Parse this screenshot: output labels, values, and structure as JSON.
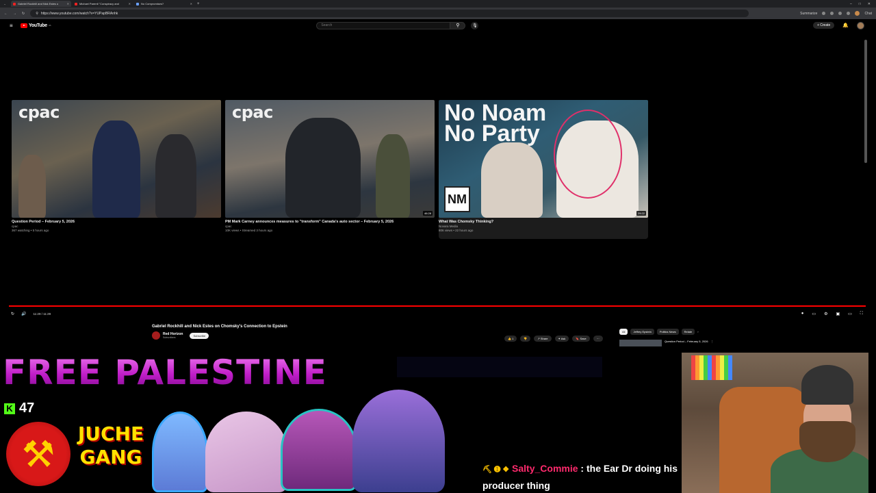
{
  "browser": {
    "tabs": [
      {
        "title": "Gabriel Rockhill and Nick Estes o",
        "active": true
      },
      {
        "title": "Michael Parenti \"Conspiracy and",
        "active": false
      },
      {
        "title": "No Compromises?",
        "active": false
      }
    ],
    "url": "https://www.youtube.com/watch?v=YUPapBRAnhk",
    "summarize_label": "Summarize",
    "chat_label": "Chat"
  },
  "youtube": {
    "logo_text": "YouTube",
    "logo_region": "CA",
    "search_placeholder": "Search",
    "create_label": "Create"
  },
  "end_screen": {
    "videos": [
      {
        "title": "Question Period – February 5, 2026",
        "channel": "cpac",
        "meta": "367 watching • 5 hours ago",
        "brand": "cpac",
        "duration": ""
      },
      {
        "title": "PM Mark Carney announces measures to \"transform\" Canada's auto sector – February 5, 2026",
        "channel": "cpac",
        "meta": "10K views • Streamed 3 hours ago",
        "brand": "cpac",
        "duration": "46:28"
      },
      {
        "title": "What Was Chomsky Thinking?",
        "channel": "Novara Media",
        "meta": "806 views • 22 hours ago",
        "headline": "No Noam No Party",
        "logo": "NM",
        "duration": "29:22"
      }
    ]
  },
  "player": {
    "time": "11:29 / 11:29",
    "progress": 1.0
  },
  "watch": {
    "title": "Gabriel Rockhill and Nick Estes on Chomsky's Connection to Epstein",
    "channel": "Red Horizon",
    "subscribers": "Subscribers",
    "subscribe_label": "Subscribe",
    "likes": "1",
    "share_label": "Share",
    "ask_label": "Ask",
    "save_label": "Save",
    "chips": [
      "All",
      "Jeffrey Epstein",
      "Politics News",
      "Relate"
    ],
    "upnext_title": "Question Period – February 5, 2026"
  },
  "overlay": {
    "banner": "FREE PALESTINE",
    "viewer_count": "47",
    "juche_text": "JUCHE GANG",
    "chat": {
      "user": "Salty_Commie",
      "message": ": the Ear Dr doing his producer thing"
    }
  },
  "colors": {
    "accent": "#ff0000",
    "kick": "#53fc18",
    "banner": "#c01dc8",
    "chat_user": "#ff2a6d"
  }
}
